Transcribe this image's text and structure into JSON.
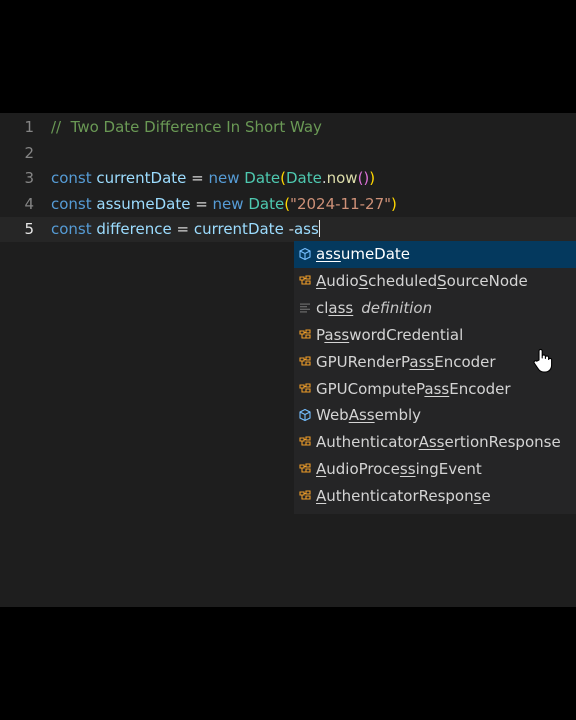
{
  "editor": {
    "lines": [
      {
        "number": "1",
        "segments": [
          {
            "text": "//  Two Date Difference In Short Way",
            "cls": "cmt"
          }
        ]
      },
      {
        "number": "2",
        "segments": []
      },
      {
        "number": "3",
        "segments": [
          {
            "text": "const ",
            "cls": "kw"
          },
          {
            "text": "currentDate",
            "cls": "var"
          },
          {
            "text": " = ",
            "cls": "op"
          },
          {
            "text": "new ",
            "cls": "kw"
          },
          {
            "text": "Date",
            "cls": "cls"
          },
          {
            "text": "(",
            "cls": "b1"
          },
          {
            "text": "Date",
            "cls": "cls"
          },
          {
            "text": ".",
            "cls": "op"
          },
          {
            "text": "now",
            "cls": "fn"
          },
          {
            "text": "()",
            "cls": "b2"
          },
          {
            "text": ")",
            "cls": "b1"
          }
        ]
      },
      {
        "number": "4",
        "segments": [
          {
            "text": "const ",
            "cls": "kw"
          },
          {
            "text": "assumeDate",
            "cls": "var"
          },
          {
            "text": " = ",
            "cls": "op"
          },
          {
            "text": "new ",
            "cls": "kw"
          },
          {
            "text": "Date",
            "cls": "cls"
          },
          {
            "text": "(",
            "cls": "b1"
          },
          {
            "text": "\"2024-11-27\"",
            "cls": "str"
          },
          {
            "text": ")",
            "cls": "b1"
          }
        ]
      },
      {
        "number": "5",
        "active": true,
        "segments": [
          {
            "text": "const ",
            "cls": "kw"
          },
          {
            "text": "difference",
            "cls": "var"
          },
          {
            "text": " = ",
            "cls": "op"
          },
          {
            "text": "currentDate",
            "cls": "var"
          },
          {
            "text": " -",
            "cls": "op"
          },
          {
            "text": "ass",
            "cls": "var"
          }
        ]
      }
    ]
  },
  "suggestions": [
    {
      "kind": "variable",
      "parts": [
        {
          "t": "ass",
          "u": true
        },
        {
          "t": "umeDate"
        }
      ],
      "selected": true
    },
    {
      "kind": "class",
      "parts": [
        {
          "t": "A",
          "u": true
        },
        {
          "t": "udio"
        },
        {
          "t": "S",
          "u": true
        },
        {
          "t": "cheduled"
        },
        {
          "t": "S",
          "u": true
        },
        {
          "t": "ourceNode"
        }
      ]
    },
    {
      "kind": "snippet",
      "parts": [
        {
          "t": "cl"
        },
        {
          "t": "ass",
          "u": true
        }
      ],
      "detail": "definition"
    },
    {
      "kind": "class",
      "parts": [
        {
          "t": "P"
        },
        {
          "t": "ass",
          "u": true
        },
        {
          "t": "wordCredential"
        }
      ]
    },
    {
      "kind": "class",
      "parts": [
        {
          "t": "GPURenderP"
        },
        {
          "t": "ass",
          "u": true
        },
        {
          "t": "Encoder"
        }
      ]
    },
    {
      "kind": "class",
      "parts": [
        {
          "t": "GPUComputeP"
        },
        {
          "t": "ass",
          "u": true
        },
        {
          "t": "Encoder"
        }
      ]
    },
    {
      "kind": "variable",
      "parts": [
        {
          "t": "Web"
        },
        {
          "t": "Ass",
          "u": true
        },
        {
          "t": "embly"
        }
      ]
    },
    {
      "kind": "class",
      "parts": [
        {
          "t": "Authenticator"
        },
        {
          "t": "Ass",
          "u": true
        },
        {
          "t": "ertionResponse"
        }
      ]
    },
    {
      "kind": "class",
      "parts": [
        {
          "t": "A",
          "u": true
        },
        {
          "t": "udioProce"
        },
        {
          "t": "ss",
          "u": true
        },
        {
          "t": "ingEvent"
        }
      ]
    },
    {
      "kind": "class",
      "parts": [
        {
          "t": "A",
          "u": true
        },
        {
          "t": "uthenticatorRespon"
        },
        {
          "t": "s",
          "u": true
        },
        {
          "t": "e"
        }
      ]
    }
  ],
  "icons": {
    "variable": "variable-icon",
    "class": "class-icon",
    "snippet": "snippet-icon",
    "pointer": "hand-pointer-icon"
  },
  "colors": {
    "background": "#000000",
    "editor_bg": "#1e1e1e",
    "selection": "#04395e",
    "keyword": "#569cd6",
    "string": "#ce9178",
    "comment": "#6a9955",
    "class_icon": "#ee9d28",
    "variable_icon": "#75beff"
  }
}
